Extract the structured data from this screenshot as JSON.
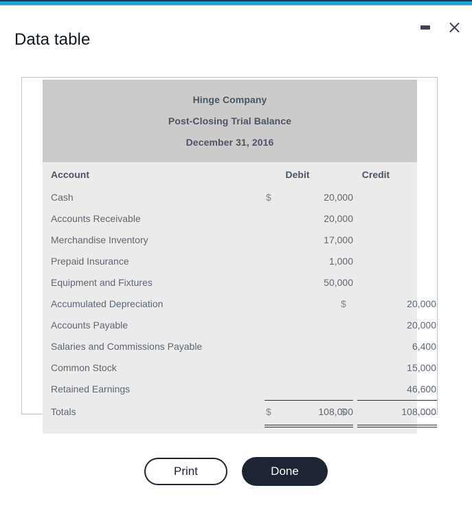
{
  "window": {
    "title": "Data table",
    "accent_color": "#1e9fe0",
    "controls": [
      {
        "name": "minimize",
        "glyph": "minimize-icon"
      },
      {
        "name": "close",
        "glyph": "close-icon"
      }
    ]
  },
  "report": {
    "company": "Hinge Company",
    "statement": "Post-Closing Trial Balance",
    "date": "December 31, 2016",
    "columns": {
      "account": "Account",
      "debit": "Debit",
      "credit": "Credit"
    },
    "currency_symbol": "$",
    "rows": [
      {
        "account": "Cash",
        "debit_sym": "$",
        "debit": "20,000",
        "credit_sym": "",
        "credit": ""
      },
      {
        "account": "Accounts Receivable",
        "debit_sym": "",
        "debit": "20,000",
        "credit_sym": "",
        "credit": ""
      },
      {
        "account": "Merchandise Inventory",
        "debit_sym": "",
        "debit": "17,000",
        "credit_sym": "",
        "credit": ""
      },
      {
        "account": "Prepaid Insurance",
        "debit_sym": "",
        "debit": "1,000",
        "credit_sym": "",
        "credit": ""
      },
      {
        "account": "Equipment and Fixtures",
        "debit_sym": "",
        "debit": "50,000",
        "credit_sym": "",
        "credit": ""
      },
      {
        "account": "Accumulated Depreciation",
        "debit_sym": "",
        "debit": "",
        "credit_sym": "$",
        "credit": "20,000"
      },
      {
        "account": "Accounts Payable",
        "debit_sym": "",
        "debit": "",
        "credit_sym": "",
        "credit": "20,000"
      },
      {
        "account": "Salaries and Commissions Payable",
        "debit_sym": "",
        "debit": "",
        "credit_sym": "",
        "credit": "6,400"
      },
      {
        "account": "Common Stock",
        "debit_sym": "",
        "debit": "",
        "credit_sym": "",
        "credit": "15,000"
      },
      {
        "account": "Retained Earnings",
        "debit_sym": "",
        "debit": "",
        "credit_sym": "",
        "credit": "46,600"
      }
    ],
    "totals": {
      "account": "Totals",
      "debit_sym": "$",
      "debit": "108,000",
      "credit_sym": "$",
      "credit": "108,000"
    }
  },
  "footer": {
    "print_label": "Print",
    "done_label": "Done"
  }
}
